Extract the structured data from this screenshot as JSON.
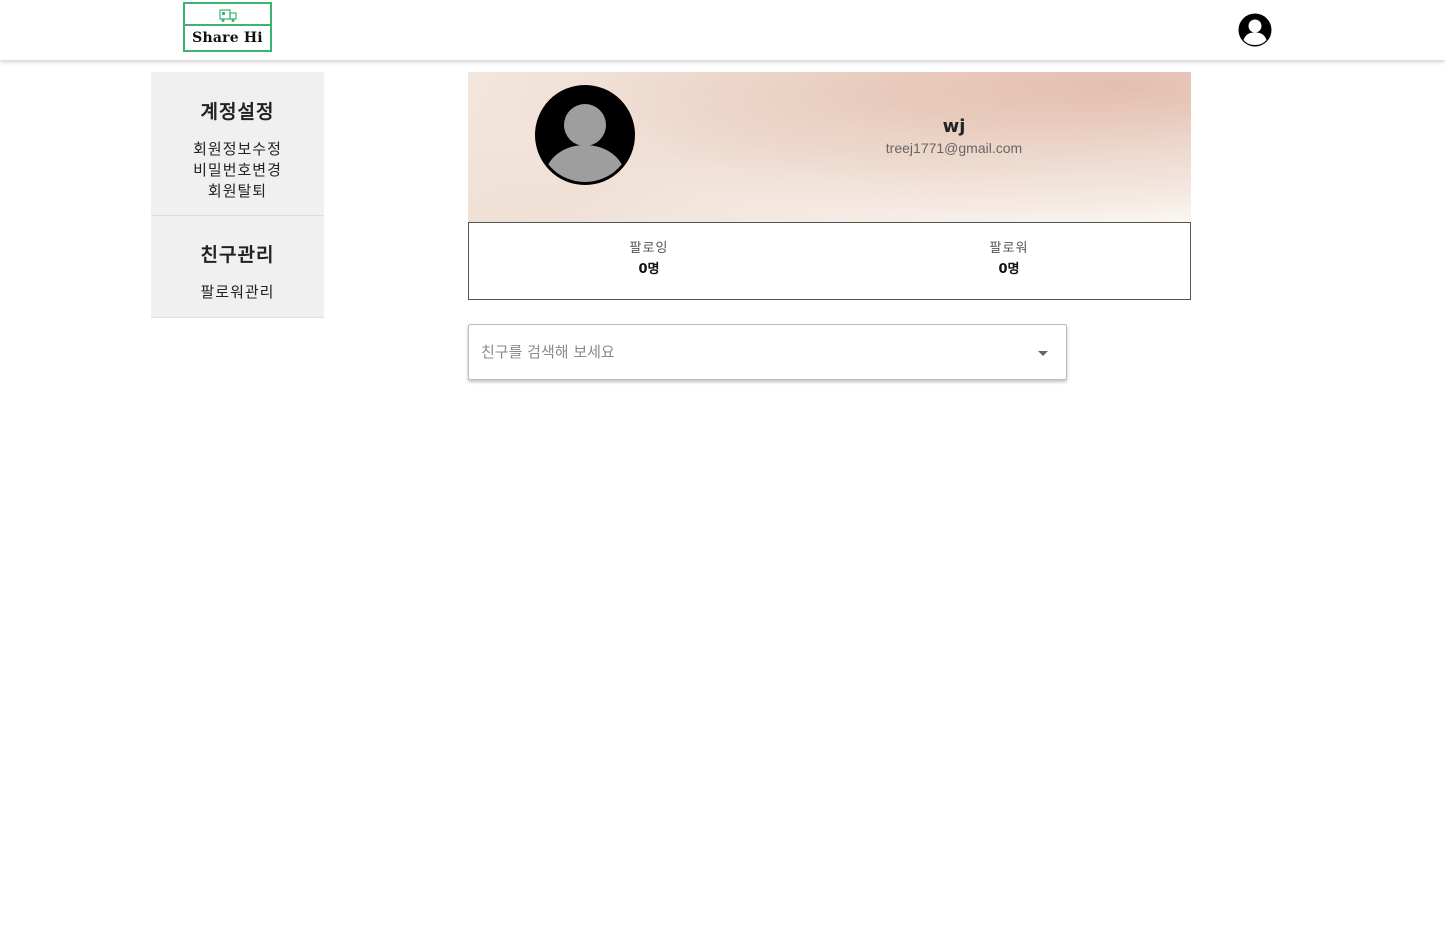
{
  "header": {
    "logo_text": "Share Hi",
    "logo_icon": "truck-icon",
    "user_icon": "account-circle-icon"
  },
  "sidebar": {
    "sections": [
      {
        "title": "계정설정",
        "items": [
          {
            "label": "회원정보수정"
          },
          {
            "label": "비밀번호변경"
          },
          {
            "label": "회원탈퇴"
          }
        ]
      },
      {
        "title": "친구관리",
        "items": [
          {
            "label": "팔로워관리"
          }
        ]
      }
    ]
  },
  "profile": {
    "name": "wj",
    "email": "treej1771@gmail.com",
    "avatar_icon": "default-avatar-icon"
  },
  "stats": {
    "following_label": "팔로잉",
    "following_value": "0명",
    "follower_label": "팔로워",
    "follower_value": "0명"
  },
  "search": {
    "placeholder": "친구를 검색해 보세요",
    "value": "",
    "dropdown_icon": "caret-down-icon"
  },
  "colors": {
    "logo_border": "#3cb371",
    "sidebar_bg": "#f0f0f0",
    "avatar_bg": "#000000",
    "avatar_figure": "#9e9e9e"
  }
}
